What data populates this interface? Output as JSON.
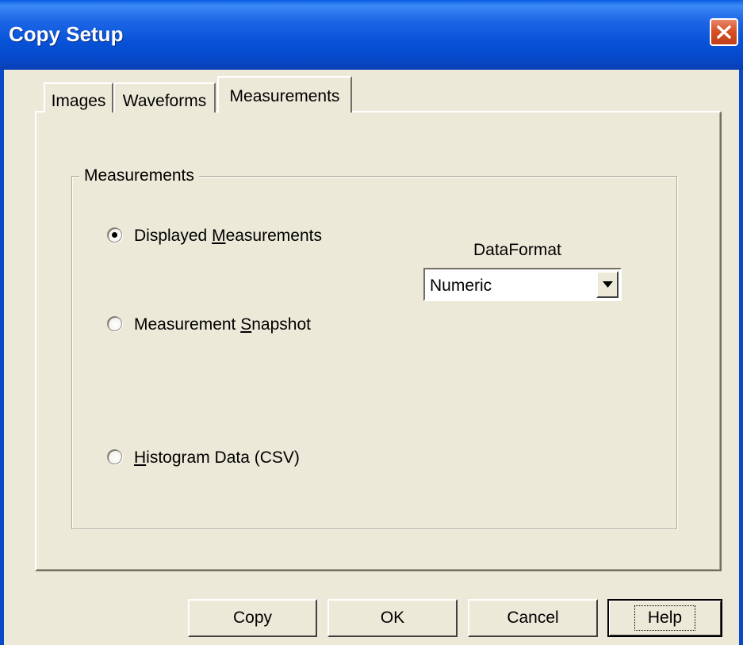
{
  "window": {
    "title": "Copy Setup",
    "close_icon": "close-icon",
    "colors": {
      "titlebar": "#0752d8",
      "close": "#d54e24",
      "face": "#ece9d8"
    }
  },
  "tabs": [
    {
      "label": "Images",
      "selected": false
    },
    {
      "label": "Waveforms",
      "selected": false
    },
    {
      "label": "Measurements",
      "selected": true
    }
  ],
  "group": {
    "label": "Measurements",
    "options": [
      {
        "pre": "Displayed ",
        "accel": "M",
        "post": "easurements",
        "checked": true
      },
      {
        "pre": "Measurement ",
        "accel": "S",
        "post": "napshot",
        "checked": false
      },
      {
        "pre": "",
        "accel": "H",
        "post": "istogram Data (CSV)",
        "checked": false
      }
    ]
  },
  "data_format": {
    "label": "DataFormat",
    "value": "Numeric"
  },
  "buttons": {
    "copy": "Copy",
    "ok": "OK",
    "cancel": "Cancel",
    "help": "Help"
  }
}
